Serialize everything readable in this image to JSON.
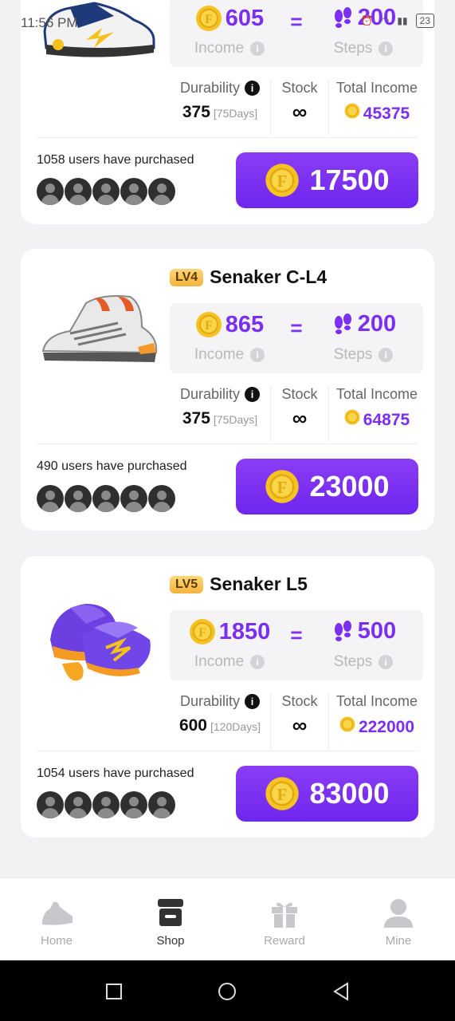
{
  "status_bar": {
    "time": "11:56 PM",
    "battery": "23"
  },
  "products": [
    {
      "income": "605",
      "steps": "200",
      "income_label": "Income",
      "steps_label": "Steps",
      "durability_label": "Durability",
      "durability": "375",
      "durability_days": "[75Days]",
      "stock_label": "Stock",
      "stock": "∞",
      "total_income_label": "Total Income",
      "total_income": "45375",
      "purchased_text": "1058 users have purchased",
      "price": "17500"
    },
    {
      "level": "LV4",
      "name": "Senaker C-L4",
      "income": "865",
      "steps": "200",
      "income_label": "Income",
      "steps_label": "Steps",
      "durability_label": "Durability",
      "durability": "375",
      "durability_days": "[75Days]",
      "stock_label": "Stock",
      "stock": "∞",
      "total_income_label": "Total Income",
      "total_income": "64875",
      "purchased_text": "490 users have purchased",
      "price": "23000"
    },
    {
      "level": "LV5",
      "name": "Senaker L5",
      "income": "1850",
      "steps": "500",
      "income_label": "Income",
      "steps_label": "Steps",
      "durability_label": "Durability",
      "durability": "600",
      "durability_days": "[120Days]",
      "stock_label": "Stock",
      "stock": "∞",
      "total_income_label": "Total Income",
      "total_income": "222000",
      "purchased_text": "1054 users have purchased",
      "price": "83000"
    }
  ],
  "nav": {
    "items": [
      {
        "label": "Home",
        "icon": "shoe-icon"
      },
      {
        "label": "Shop",
        "icon": "shop-icon"
      },
      {
        "label": "Reward",
        "icon": "gift-icon"
      },
      {
        "label": "Mine",
        "icon": "user-icon"
      }
    ],
    "active": "Shop"
  },
  "colors": {
    "accent": "#7b2ff2",
    "coin": "#f6c324",
    "badge": "#f3b33a"
  }
}
